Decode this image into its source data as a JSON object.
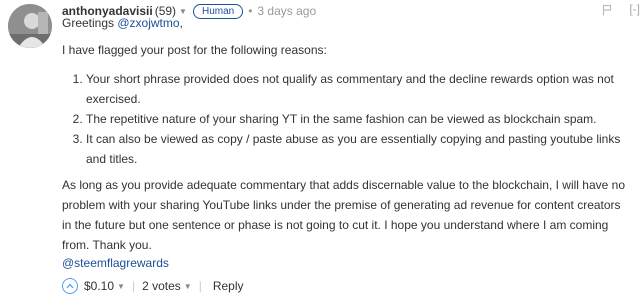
{
  "header": {
    "author": "anthonyadavisii",
    "reputation": "(59)",
    "badge": "Human",
    "separator": "•",
    "time": "3 days ago",
    "collapse": "[-]"
  },
  "body": {
    "greeting_prefix": "Greetings ",
    "mention": "@zxojwtmo",
    "greeting_suffix": ",",
    "intro": "I have flagged your post for the following reasons:",
    "reasons": [
      "Your short phrase provided does not qualify as commentary and the decline rewards option was not exercised.",
      "The repetitive nature of your sharing YT in the same fashion can be viewed as blockchain spam.",
      "It can also be viewed as copy / paste abuse as you are essentially copying and pasting youtube links and titles."
    ],
    "closing": "As long as you provide adequate commentary that adds discernable value to the blockchain, I will have no problem with your sharing YouTube links under the premise of generating ad revenue for content creators in the future but one sentence or phase is not going to cut it. I hope you understand where I am coming from. Thank you.",
    "signature": "@steemflagrewards"
  },
  "footer": {
    "payout": "$0.10",
    "votes": "2 votes",
    "reply": "Reply",
    "divider": "|"
  },
  "colors": {
    "link": "#1a5099",
    "upvote": "#4ba2f2",
    "muted": "#999999"
  }
}
